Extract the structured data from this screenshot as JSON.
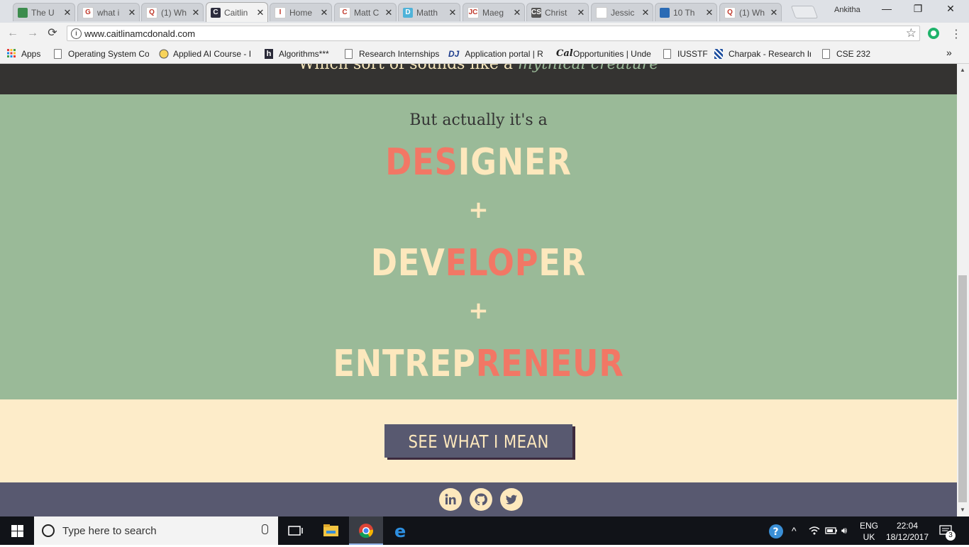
{
  "browser": {
    "tabs": [
      {
        "label": "The U",
        "favicon_color": "#3c8c4d",
        "favicon_glyph": ""
      },
      {
        "label": "what i",
        "favicon_color": "#ffffff",
        "favicon_glyph": "G"
      },
      {
        "label": "(1) Wh",
        "favicon_color": "#ffffff",
        "favicon_glyph": "Q"
      },
      {
        "label": "Caitlin",
        "favicon_color": "#2d2d3d",
        "favicon_glyph": "C",
        "active": true
      },
      {
        "label": "Home",
        "favicon_color": "#ffffff",
        "favicon_glyph": "I"
      },
      {
        "label": "Matt C",
        "favicon_color": "#ffffff",
        "favicon_glyph": "C"
      },
      {
        "label": "Matth",
        "favicon_color": "#4fb3d9",
        "favicon_glyph": "D"
      },
      {
        "label": "Maeg",
        "favicon_color": "#ffffff",
        "favicon_glyph": "JC"
      },
      {
        "label": "Christ",
        "favicon_color": "#555555",
        "favicon_glyph": "CS"
      },
      {
        "label": "Jessic",
        "favicon_color": "#ffffff",
        "favicon_glyph": ""
      },
      {
        "label": "10 Th",
        "favicon_color": "#2a6bb5",
        "favicon_glyph": ""
      },
      {
        "label": "(1) Wh",
        "favicon_color": "#ffffff",
        "favicon_glyph": "Q"
      }
    ],
    "tab_close_glyph": "✕",
    "profile_name": "Ankitha",
    "window_controls": {
      "minimize": "—",
      "restore": "❐",
      "close": "✕"
    },
    "nav": {
      "back": "←",
      "forward": "→",
      "reload": "⟳"
    },
    "url": "www.caitlinamcdonald.com",
    "star_glyph": "☆",
    "menu_glyph": "⋮",
    "bookmarks": [
      {
        "label": "Apps",
        "icon": "apps-grid-icon"
      },
      {
        "label": "Operating System Co",
        "icon": "page-icon"
      },
      {
        "label": "Applied AI Course - I",
        "icon": "course-icon"
      },
      {
        "label": "Algorithms***",
        "icon": "hackerrank-icon"
      },
      {
        "label": "Research Internships",
        "icon": "page-icon"
      },
      {
        "label": "Application portal | R",
        "icon": "dj-icon"
      },
      {
        "label": "Opportunities | Unde",
        "icon": "cal-icon"
      },
      {
        "label": "IUSSTF",
        "icon": "page-icon"
      },
      {
        "label": "Charpak - Research Ir",
        "icon": "charpak-icon"
      },
      {
        "label": "CSE 232",
        "icon": "page-icon"
      }
    ],
    "bookmarks_overflow": "»"
  },
  "page": {
    "partial_line": "Which sort of sounds like a ",
    "partial_line_em": "mythical creature",
    "lead": "But actually it's a",
    "words": [
      {
        "before": "",
        "highlight": "DES",
        "after": "IGNER"
      },
      {
        "before": "DEV",
        "highlight": "ELOP",
        "after": "ER"
      },
      {
        "before": "ENTREP",
        "highlight": "RENEUR",
        "after": ""
      }
    ],
    "plus": "+",
    "cta_label": "SEE WHAT I MEAN",
    "social": [
      "linkedin-icon",
      "github-icon",
      "twitter-icon"
    ],
    "colors": {
      "dark": "#343331",
      "sage": "#9aba98",
      "cream": "#fde8bd",
      "coral": "#f27765",
      "slate": "#585970"
    }
  },
  "taskbar": {
    "search_placeholder": "Type here to search",
    "language_line1": "ENG",
    "language_line2": "UK",
    "time": "22:04",
    "date": "18/12/2017",
    "notification_count": "3"
  }
}
